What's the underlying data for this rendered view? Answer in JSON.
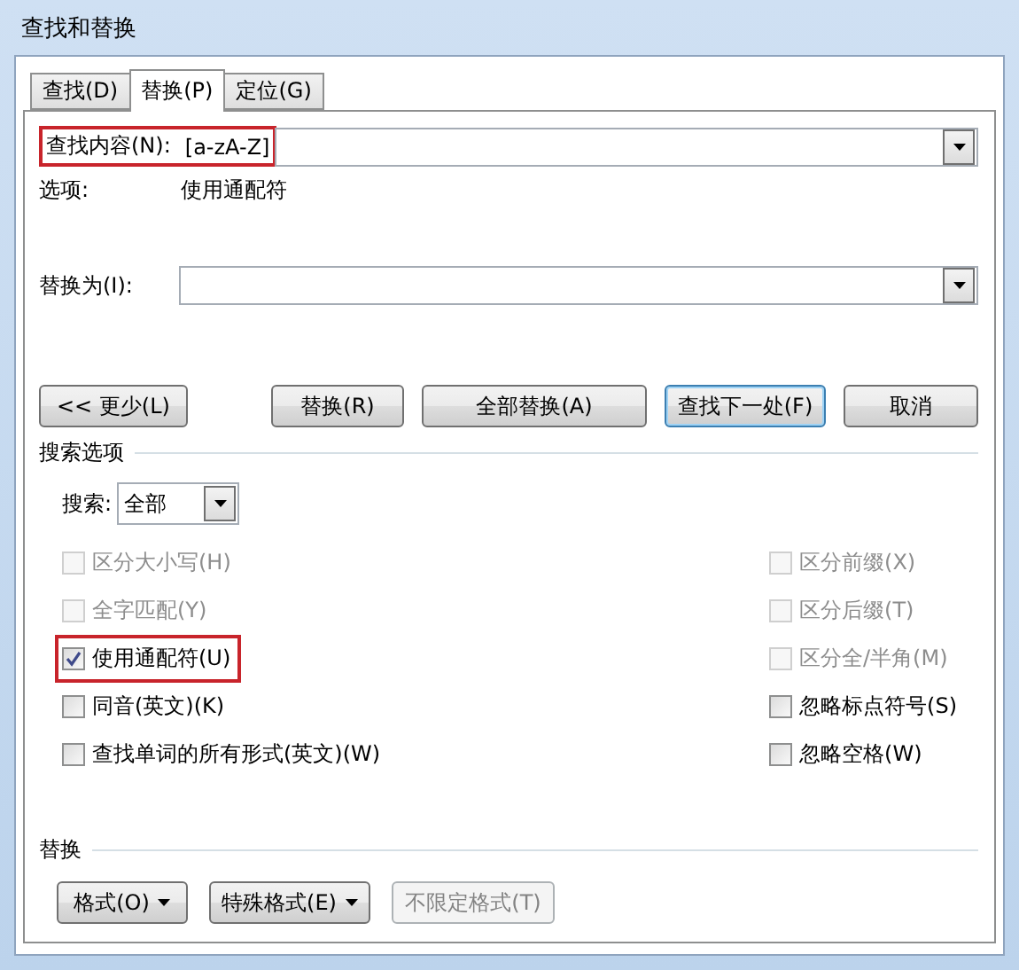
{
  "window": {
    "title": "查找和替换"
  },
  "tabs": [
    {
      "label": "查找(D)",
      "selected": false
    },
    {
      "label": "替换(P)",
      "selected": true
    },
    {
      "label": "定位(G)",
      "selected": false
    }
  ],
  "find": {
    "label": "查找内容(N):",
    "value": "[a-zA-Z]",
    "highlighted": true
  },
  "options": {
    "label": "选项:",
    "value": "使用通配符"
  },
  "replace": {
    "label": "替换为(I):"
  },
  "buttons": [
    {
      "label": "<< 更少(L)",
      "focused": false
    },
    {
      "label": "替换(R)",
      "focused": false
    },
    {
      "label": "全部替换(A)",
      "focused": false
    },
    {
      "label": "查找下一处(F)",
      "focused": true
    },
    {
      "label": "取消",
      "focused": false
    }
  ],
  "search_options": {
    "title": "搜索选项",
    "search_label": "搜索:",
    "search_value": "全部",
    "left": [
      {
        "label": "区分大小写(H)",
        "checked": false,
        "disabled": true,
        "highlighted": false
      },
      {
        "label": "全字匹配(Y)",
        "checked": false,
        "disabled": true,
        "highlighted": false
      },
      {
        "label": "使用通配符(U)",
        "checked": true,
        "disabled": false,
        "highlighted": true
      },
      {
        "label": "同音(英文)(K)",
        "checked": false,
        "disabled": false,
        "highlighted": false
      },
      {
        "label": "查找单词的所有形式(英文)(W)",
        "checked": false,
        "disabled": false,
        "highlighted": false
      }
    ],
    "right": [
      {
        "label": "区分前缀(X)",
        "checked": false,
        "disabled": true,
        "highlighted": false
      },
      {
        "label": "区分后缀(T)",
        "checked": false,
        "disabled": true,
        "highlighted": false
      },
      {
        "label": "区分全/半角(M)",
        "checked": false,
        "disabled": true,
        "highlighted": false
      },
      {
        "label": "忽略标点符号(S)",
        "checked": false,
        "disabled": false,
        "highlighted": false
      },
      {
        "label": "忽略空格(W)",
        "checked": false,
        "disabled": false,
        "highlighted": false
      }
    ]
  },
  "replace_section": {
    "title": "替换",
    "buttons": [
      {
        "label": "格式(O)",
        "dropdown": true,
        "disabled": false
      },
      {
        "label": "特殊格式(E)",
        "dropdown": true,
        "disabled": false
      },
      {
        "label": "不限定格式(T)",
        "dropdown": false,
        "disabled": true
      }
    ]
  }
}
